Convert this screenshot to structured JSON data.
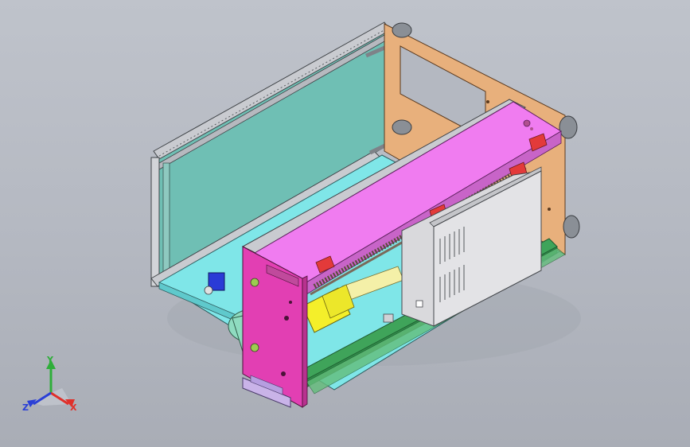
{
  "viewport": {
    "background_top": "#bfc3cb",
    "background_bottom": "#a9adb6"
  },
  "model": {
    "colors": {
      "frame_panel": "#6fbfb4",
      "end_plate": "#e8b07c",
      "magenta_cover": "#f07cf0",
      "front_plate": "#e23fb3",
      "motor_yellow": "#f4ef2a",
      "rail_green": "#3fa45a",
      "base_cyan": "#7fe6e8",
      "power_supply": "#d9d9dc",
      "red_brackets": "#e33a3a",
      "gear_blue": "#2a3bd6",
      "motor_green": "#8fdcc0",
      "foot_lilac": "#c9b3e8"
    }
  },
  "triad": {
    "x_label": "X",
    "y_label": "Y",
    "z_label": "Z",
    "x_color": "#e0302a",
    "y_color": "#2fae3a",
    "z_color": "#2a3fd6"
  }
}
